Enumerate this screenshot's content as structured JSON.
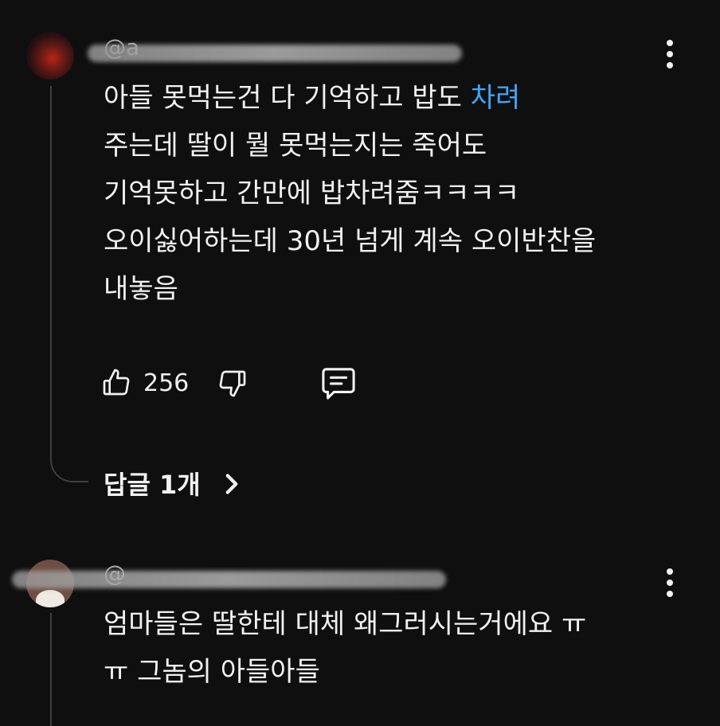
{
  "comment1": {
    "handle": "@a",
    "lines": [
      "아들 못먹는건 다 기억하고 밥도 ",
      "주는데 딸이 뭘 못먹는지는 죽어도",
      "기억못하고 간만에 밥차려줌ㅋㅋㅋㅋ",
      "오이싫어하는데 30년 넘게 계속 오이반찬을",
      "내놓음"
    ],
    "link_text": "차려",
    "likes": "256",
    "replies_label": "답글 1개"
  },
  "comment2": {
    "handle": "@",
    "lines": [
      "엄마들은 딸한테 대체 왜그러시는거에요 ㅠ",
      "ㅠ 그놈의 아들아들"
    ]
  },
  "icons": {
    "like": "thumbs-up-icon",
    "dislike": "thumbs-down-icon",
    "reply": "comment-icon",
    "menu": "more-vert-icon",
    "chevron": "chevron-right-icon"
  },
  "colors": {
    "background": "#0f0f0f",
    "text": "#f1f1f1",
    "link": "#3ea6ff",
    "secondary": "#aaaaaa"
  }
}
